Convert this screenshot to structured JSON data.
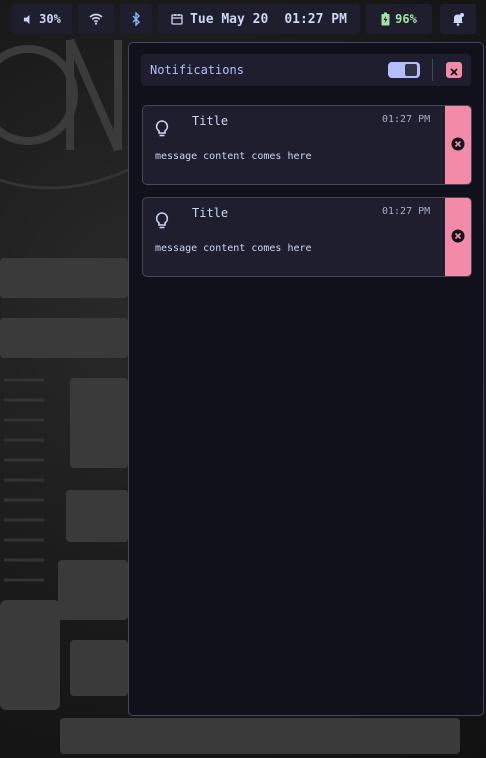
{
  "statusbar": {
    "volume_label": "30%",
    "volume_icon": "speaker-icon",
    "wifi_icon": "wifi-icon",
    "bluetooth_icon": "bluetooth-icon",
    "calendar_icon": "calendar-icon",
    "date": "Tue May 20",
    "time": "01:27 PM",
    "battery_label": "96%",
    "battery_icon": "battery-charging-icon",
    "notifications_icon": "bell-icon"
  },
  "panel": {
    "title": "Notifications",
    "dnd_toggle_on": true,
    "clear_icon": "close-icon"
  },
  "notifications": [
    {
      "title": "Title",
      "time": "01:27 PM",
      "body": "message content comes here",
      "icon": "lightbulb-icon"
    },
    {
      "title": "Title",
      "time": "01:27 PM",
      "body": "message content comes here",
      "icon": "lightbulb-icon"
    }
  ],
  "colors": {
    "bar_bg": "#1e1e2e",
    "panel_bg": "#11111b",
    "accent": "#b4befe",
    "danger": "#f38ba8",
    "battery": "#a6e3a1",
    "text": "#cdd6f4"
  }
}
